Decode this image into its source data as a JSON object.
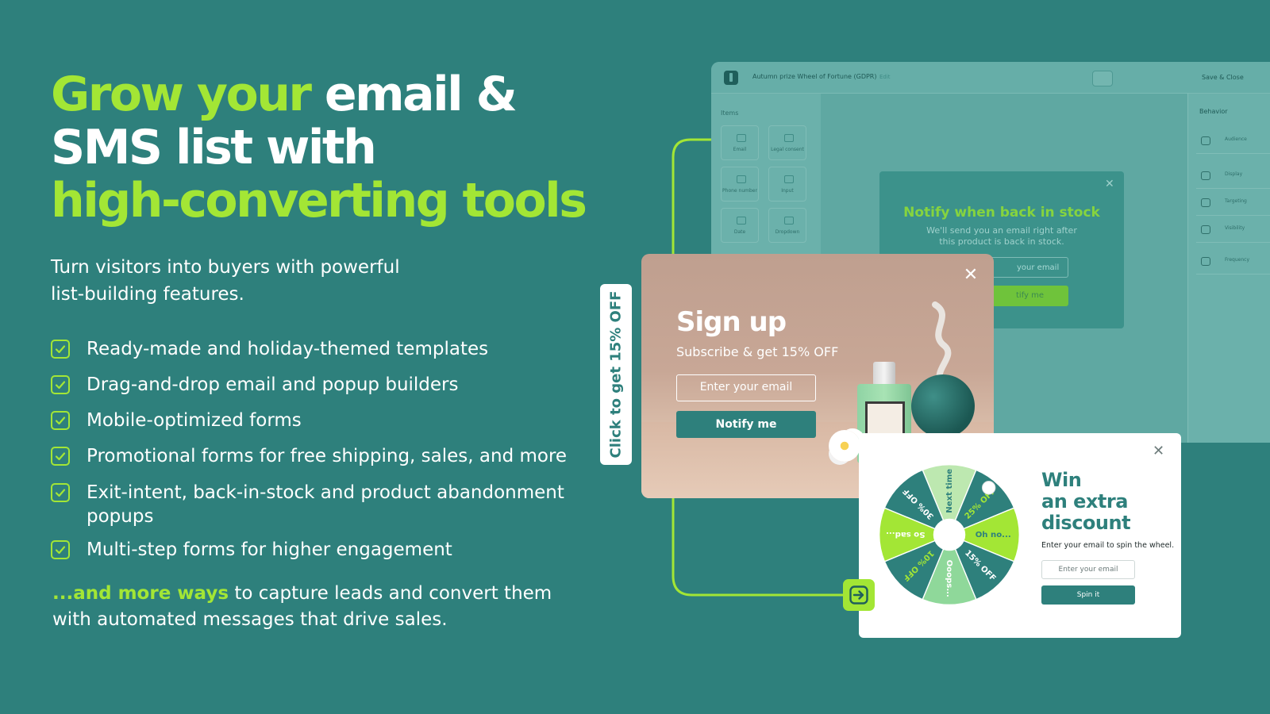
{
  "headline": {
    "part1": "Grow your",
    "part2": " email &",
    "part3": "SMS list with",
    "part4": "high-converting tools"
  },
  "intro": {
    "line1": "Turn visitors into buyers with powerful",
    "line2": "list-building features."
  },
  "features": [
    {
      "line1": "Ready-made and holiday-themed templates"
    },
    {
      "line1": "Drag-and-drop email and popup builders"
    },
    {
      "line1": "Mobile-optimized forms"
    },
    {
      "line1": "Promotional forms for free shipping, sales, and more"
    },
    {
      "line1": "Exit-intent, back-in-stock and product abandonment",
      "line2": "popups"
    },
    {
      "line1": "Multi-step forms for higher engagement"
    }
  ],
  "outro": {
    "highlight": "...and more ways",
    "text1": " to capture leads and convert them",
    "text2": "with automated messages that drive sales."
  },
  "builder": {
    "title": "Autumn prize Wheel of Fortune (GDPR)",
    "edit": "Edit",
    "save_close": "Save & Close",
    "items_label": "Items",
    "items": [
      {
        "label": "Email"
      },
      {
        "label": "Legal consent"
      },
      {
        "label": "Phone number"
      },
      {
        "label": "Input"
      },
      {
        "label": "Date"
      },
      {
        "label": "Dropdown"
      }
    ],
    "behavior_label": "Behavior",
    "behavior_rows": [
      "Audience",
      "Display",
      "Targeting",
      "Visibility",
      "Frequency"
    ],
    "notify": {
      "title": "Notify when back in stock",
      "sub1": "We'll send you an email right after",
      "sub2": "this product is back in stock.",
      "input": "your email",
      "button": "tify me"
    }
  },
  "vertical_tab": {
    "label": "Click to get 15% OFF"
  },
  "signup": {
    "title": "Sign up",
    "subtitle": "Subscribe & get 15% OFF",
    "input_placeholder": "Enter your email",
    "button": "Notify me",
    "close": "✕"
  },
  "wheel": {
    "title1": "Win",
    "title2": "an extra",
    "title3": "discount",
    "subtitle": "Enter your email to spin the wheel.",
    "input_placeholder": "Enter your email",
    "button": "Spin it",
    "close": "✕",
    "segments": [
      {
        "label": "Next time",
        "color": "#bde8b0",
        "text": "#2e807c"
      },
      {
        "label": "25% OFF",
        "color": "#2e807c",
        "text": "#a3e635"
      },
      {
        "label": "Oh no...",
        "color": "#a3e635",
        "text": "#2e807c"
      },
      {
        "label": "15% OFF",
        "color": "#2e807c",
        "text": "#ffffff"
      },
      {
        "label": "Ooops...",
        "color": "#8fd89a",
        "text": "#ffffff"
      },
      {
        "label": "10% OFF",
        "color": "#2e807c",
        "text": "#a3e635"
      },
      {
        "label": "So sad...",
        "color": "#a3e635",
        "text": "#ffffff"
      },
      {
        "label": "30% OFF",
        "color": "#2e807c",
        "text": "#ffffff"
      }
    ]
  },
  "colors": {
    "background": "#2e807c",
    "accent": "#a3e635",
    "white": "#ffffff"
  }
}
